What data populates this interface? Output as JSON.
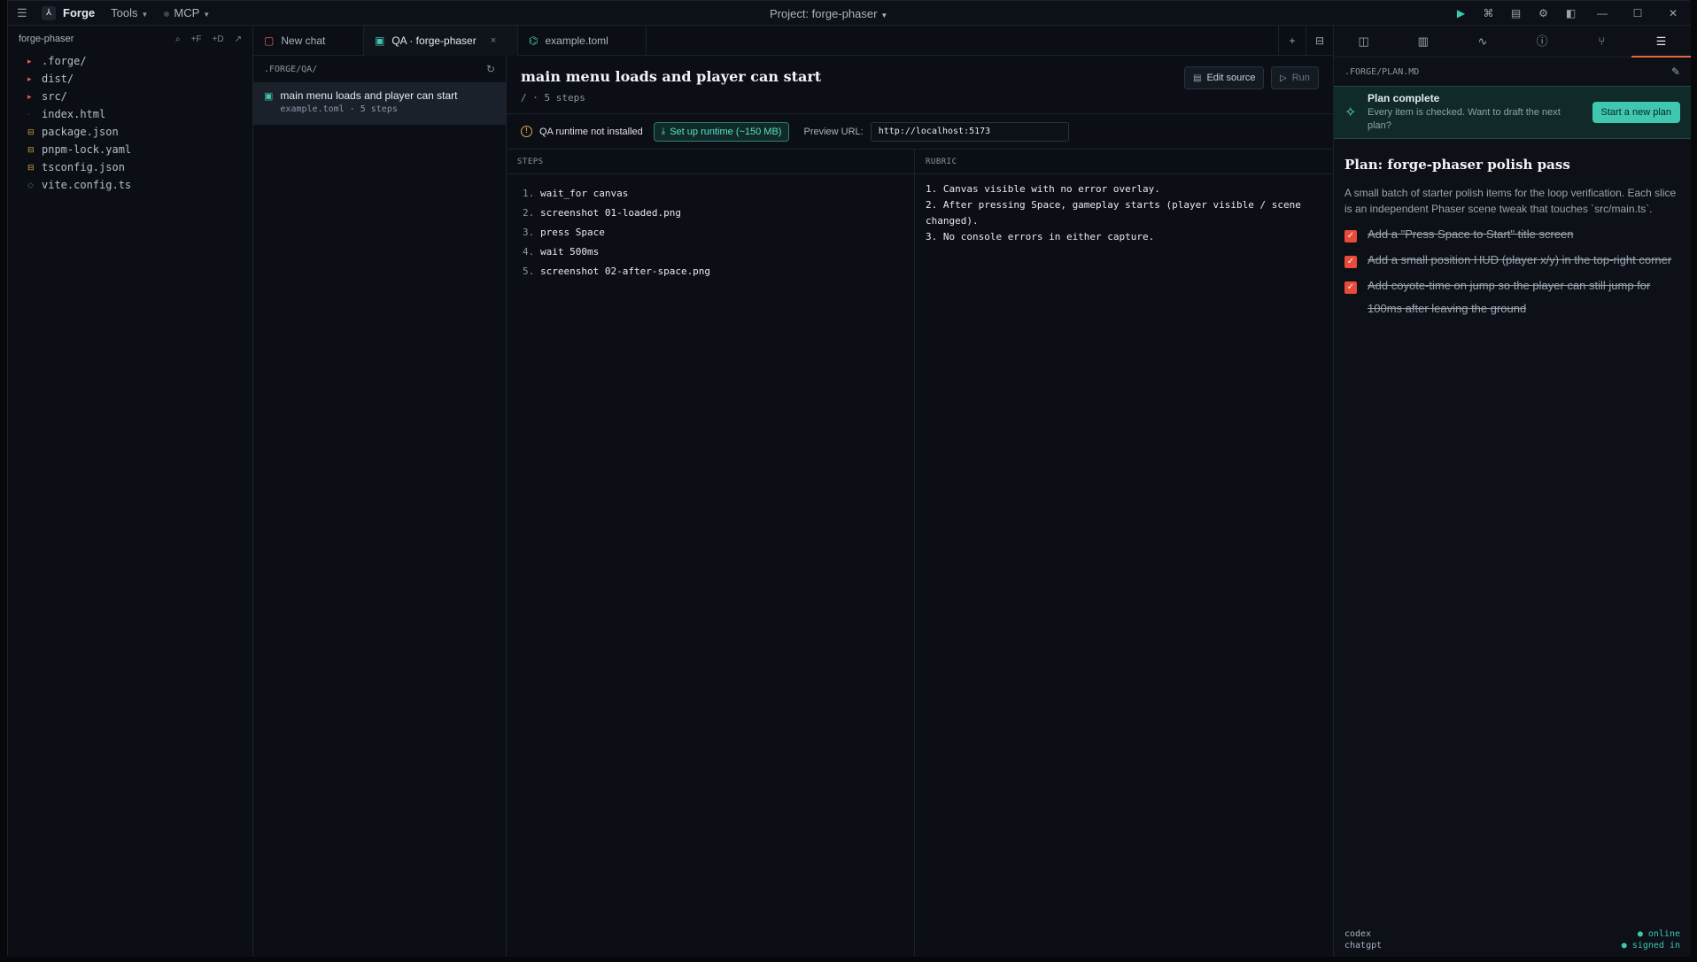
{
  "titlebar": {
    "app_name": "Forge",
    "tools_label": "Tools",
    "mcp_label": "MCP",
    "project_title": "Project: forge-phaser"
  },
  "explorer": {
    "root": "forge-phaser",
    "actions": [
      "⌕",
      "+F",
      "+D",
      "↗"
    ],
    "items": [
      {
        "name": ".forge/",
        "kind": "dir"
      },
      {
        "name": "dist/",
        "kind": "dir"
      },
      {
        "name": "src/",
        "kind": "dir"
      },
      {
        "name": "index.html",
        "kind": "html"
      },
      {
        "name": "package.json",
        "kind": "json"
      },
      {
        "name": "pnpm-lock.yaml",
        "kind": "json"
      },
      {
        "name": "tsconfig.json",
        "kind": "json"
      },
      {
        "name": "vite.config.ts",
        "kind": "ts"
      }
    ]
  },
  "tabs": [
    {
      "label": "New chat",
      "icon": "chat-icon"
    },
    {
      "label": "QA · forge-phaser",
      "icon": "clipboard-icon",
      "active": true,
      "close": "×"
    },
    {
      "label": "example.toml",
      "icon": "file-code-icon"
    }
  ],
  "qa_list": {
    "path": ".FORGE/QA/",
    "items": [
      {
        "title": "main menu loads and player can start",
        "meta": "example.toml · 5 steps"
      }
    ]
  },
  "qa_detail": {
    "title": "main menu loads and player can start",
    "subtitle": "/ · 5 steps",
    "edit_label": "Edit source",
    "run_label": "Run",
    "warning": "QA runtime not installed",
    "setup_label": "Set up runtime (~150 MB)",
    "preview_label": "Preview URL:",
    "preview_url": "http://localhost:5173",
    "steps_header": "STEPS",
    "rubric_header": "RUBRIC",
    "steps": [
      {
        "num": "1.",
        "text": "wait_for canvas"
      },
      {
        "num": "2.",
        "text": "screenshot 01-loaded.png"
      },
      {
        "num": "3.",
        "text": "press Space"
      },
      {
        "num": "4.",
        "text": "wait 500ms"
      },
      {
        "num": "5.",
        "text": "screenshot 02-after-space.png"
      }
    ],
    "rubric": [
      "1. Canvas visible with no error overlay.",
      "2. After pressing Space, gameplay starts (player visible / scene changed).",
      "3. No console errors in either capture."
    ]
  },
  "right_panel": {
    "path": ".FORGE/PLAN.MD",
    "banner_title": "Plan complete",
    "banner_text": "Every item is checked. Want to draft the next plan?",
    "banner_button": "Start a new plan",
    "plan_title": "Plan: forge-phaser polish pass",
    "plan_desc": "A small batch of starter polish items for the loop verification. Each slice is an independent Phaser scene tweak that touches `src/main.ts`.",
    "items": [
      "Add a \"Press Space to Start\" title screen",
      "Add a small position HUD (player x/y) in the top-right corner",
      "Add coyote-time on jump so the player can still jump for 100ms after leaving the ground"
    ],
    "footer": [
      {
        "left": "codex",
        "right": "● online"
      },
      {
        "left": "chatgpt",
        "right": "● signed in"
      }
    ]
  },
  "colors": {
    "accent": "#3fc7b0",
    "warning": "#e0a94b",
    "checkbox": "#e84a3c",
    "active_tab_underline": "#e06b3a"
  }
}
